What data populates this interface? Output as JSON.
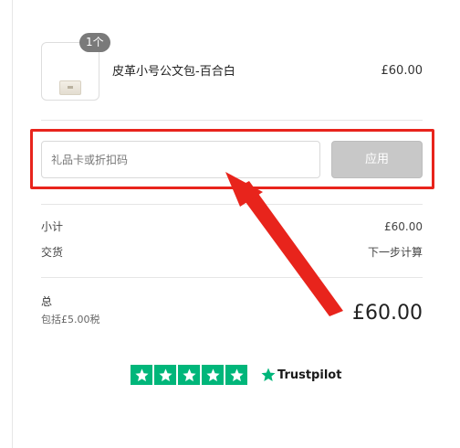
{
  "cart_item": {
    "quantity_badge": "1个",
    "name": "皮革小号公文包-百合白",
    "price": "£60.00"
  },
  "discount": {
    "placeholder": "礼品卡或折扣码",
    "value": "",
    "apply_label": "应用"
  },
  "summary": {
    "subtotal_label": "小计",
    "subtotal_value": "£60.00",
    "shipping_label": "交货",
    "shipping_value": "下一步计算"
  },
  "total": {
    "label": "总",
    "tax_note": "包括£5.00税",
    "value": "£60.00"
  },
  "trustpilot": {
    "brand": "Trustpilot",
    "rating_stars": 5,
    "color": "#00b67a"
  },
  "annotation": {
    "color": "#e8241c"
  }
}
